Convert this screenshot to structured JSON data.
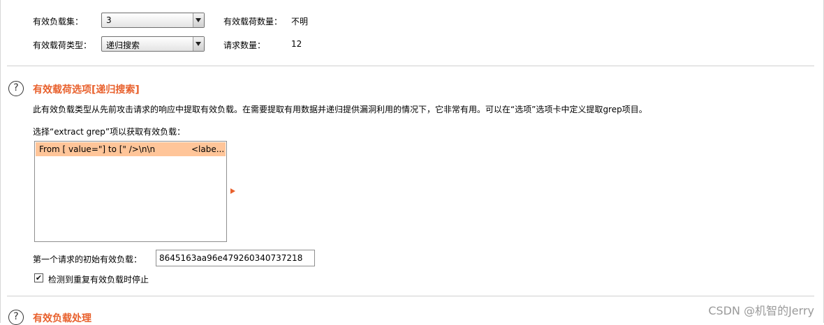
{
  "payload_settings": {
    "payload_set_label": "有效负载集：",
    "payload_set_value": "3",
    "payload_count_label": "有效载荷数量：",
    "payload_count_value": "不明",
    "payload_type_label": "有效载荷类型：",
    "payload_type_value": "递归搜索",
    "request_count_label": "请求数量：",
    "request_count_value": "12"
  },
  "options_section": {
    "title": "有效载荷选项[递归搜索]",
    "description": "此有效负载类型从先前攻击请求的响应中提取有效负载。在需要提取有用数据并递归提供漏洞利用的情况下，它非常有用。可以在“选项”选项卡中定义提取grep项目。",
    "select_label": "选择“extract grep”项以获取有效负载：",
    "grep_items": [
      {
        "from_to": "From [ value=\"] to [\" />\\n\\n",
        "extra": "<labe..."
      }
    ],
    "initial_payload_label": "第一个请求的初始有效负载：",
    "initial_payload_value": "8645163aa96e479260340737218",
    "stop_on_duplicate_label": "检测到重复有效负载时停止",
    "stop_on_duplicate_checked": true
  },
  "processing_section": {
    "title": "有效负载处理"
  },
  "watermark": "CSDN @机智的Jerry"
}
